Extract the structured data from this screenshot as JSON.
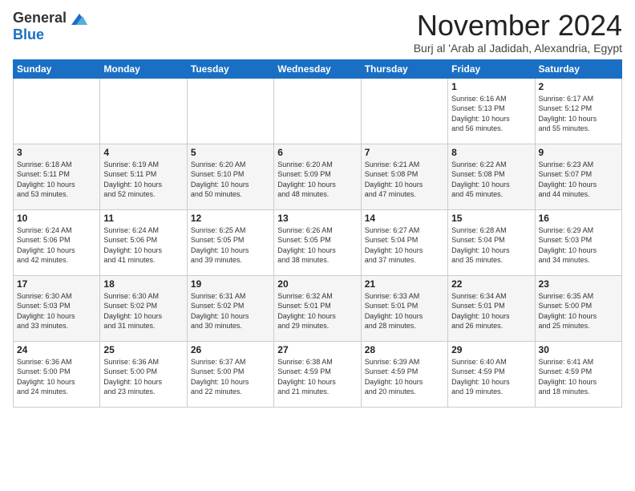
{
  "header": {
    "logo_general": "General",
    "logo_blue": "Blue",
    "month_title": "November 2024",
    "subtitle": "Burj al 'Arab al Jadidah, Alexandria, Egypt"
  },
  "weekdays": [
    "Sunday",
    "Monday",
    "Tuesday",
    "Wednesday",
    "Thursday",
    "Friday",
    "Saturday"
  ],
  "weeks": [
    [
      {
        "day": "",
        "info": ""
      },
      {
        "day": "",
        "info": ""
      },
      {
        "day": "",
        "info": ""
      },
      {
        "day": "",
        "info": ""
      },
      {
        "day": "",
        "info": ""
      },
      {
        "day": "1",
        "info": "Sunrise: 6:16 AM\nSunset: 5:13 PM\nDaylight: 10 hours\nand 56 minutes."
      },
      {
        "day": "2",
        "info": "Sunrise: 6:17 AM\nSunset: 5:12 PM\nDaylight: 10 hours\nand 55 minutes."
      }
    ],
    [
      {
        "day": "3",
        "info": "Sunrise: 6:18 AM\nSunset: 5:11 PM\nDaylight: 10 hours\nand 53 minutes."
      },
      {
        "day": "4",
        "info": "Sunrise: 6:19 AM\nSunset: 5:11 PM\nDaylight: 10 hours\nand 52 minutes."
      },
      {
        "day": "5",
        "info": "Sunrise: 6:20 AM\nSunset: 5:10 PM\nDaylight: 10 hours\nand 50 minutes."
      },
      {
        "day": "6",
        "info": "Sunrise: 6:20 AM\nSunset: 5:09 PM\nDaylight: 10 hours\nand 48 minutes."
      },
      {
        "day": "7",
        "info": "Sunrise: 6:21 AM\nSunset: 5:08 PM\nDaylight: 10 hours\nand 47 minutes."
      },
      {
        "day": "8",
        "info": "Sunrise: 6:22 AM\nSunset: 5:08 PM\nDaylight: 10 hours\nand 45 minutes."
      },
      {
        "day": "9",
        "info": "Sunrise: 6:23 AM\nSunset: 5:07 PM\nDaylight: 10 hours\nand 44 minutes."
      }
    ],
    [
      {
        "day": "10",
        "info": "Sunrise: 6:24 AM\nSunset: 5:06 PM\nDaylight: 10 hours\nand 42 minutes."
      },
      {
        "day": "11",
        "info": "Sunrise: 6:24 AM\nSunset: 5:06 PM\nDaylight: 10 hours\nand 41 minutes."
      },
      {
        "day": "12",
        "info": "Sunrise: 6:25 AM\nSunset: 5:05 PM\nDaylight: 10 hours\nand 39 minutes."
      },
      {
        "day": "13",
        "info": "Sunrise: 6:26 AM\nSunset: 5:05 PM\nDaylight: 10 hours\nand 38 minutes."
      },
      {
        "day": "14",
        "info": "Sunrise: 6:27 AM\nSunset: 5:04 PM\nDaylight: 10 hours\nand 37 minutes."
      },
      {
        "day": "15",
        "info": "Sunrise: 6:28 AM\nSunset: 5:04 PM\nDaylight: 10 hours\nand 35 minutes."
      },
      {
        "day": "16",
        "info": "Sunrise: 6:29 AM\nSunset: 5:03 PM\nDaylight: 10 hours\nand 34 minutes."
      }
    ],
    [
      {
        "day": "17",
        "info": "Sunrise: 6:30 AM\nSunset: 5:03 PM\nDaylight: 10 hours\nand 33 minutes."
      },
      {
        "day": "18",
        "info": "Sunrise: 6:30 AM\nSunset: 5:02 PM\nDaylight: 10 hours\nand 31 minutes."
      },
      {
        "day": "19",
        "info": "Sunrise: 6:31 AM\nSunset: 5:02 PM\nDaylight: 10 hours\nand 30 minutes."
      },
      {
        "day": "20",
        "info": "Sunrise: 6:32 AM\nSunset: 5:01 PM\nDaylight: 10 hours\nand 29 minutes."
      },
      {
        "day": "21",
        "info": "Sunrise: 6:33 AM\nSunset: 5:01 PM\nDaylight: 10 hours\nand 28 minutes."
      },
      {
        "day": "22",
        "info": "Sunrise: 6:34 AM\nSunset: 5:01 PM\nDaylight: 10 hours\nand 26 minutes."
      },
      {
        "day": "23",
        "info": "Sunrise: 6:35 AM\nSunset: 5:00 PM\nDaylight: 10 hours\nand 25 minutes."
      }
    ],
    [
      {
        "day": "24",
        "info": "Sunrise: 6:36 AM\nSunset: 5:00 PM\nDaylight: 10 hours\nand 24 minutes."
      },
      {
        "day": "25",
        "info": "Sunrise: 6:36 AM\nSunset: 5:00 PM\nDaylight: 10 hours\nand 23 minutes."
      },
      {
        "day": "26",
        "info": "Sunrise: 6:37 AM\nSunset: 5:00 PM\nDaylight: 10 hours\nand 22 minutes."
      },
      {
        "day": "27",
        "info": "Sunrise: 6:38 AM\nSunset: 4:59 PM\nDaylight: 10 hours\nand 21 minutes."
      },
      {
        "day": "28",
        "info": "Sunrise: 6:39 AM\nSunset: 4:59 PM\nDaylight: 10 hours\nand 20 minutes."
      },
      {
        "day": "29",
        "info": "Sunrise: 6:40 AM\nSunset: 4:59 PM\nDaylight: 10 hours\nand 19 minutes."
      },
      {
        "day": "30",
        "info": "Sunrise: 6:41 AM\nSunset: 4:59 PM\nDaylight: 10 hours\nand 18 minutes."
      }
    ]
  ]
}
